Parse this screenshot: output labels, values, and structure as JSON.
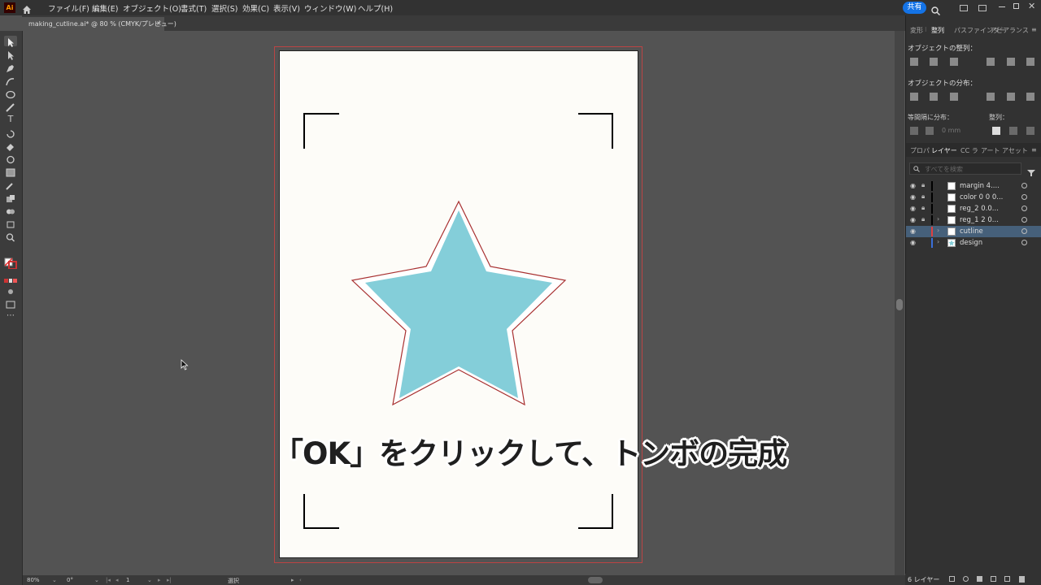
{
  "app": {
    "logo": "Ai",
    "menu": [
      "ファイル(F)",
      "編集(E)",
      "オブジェクト(O)",
      "書式(T)",
      "選択(S)",
      "効果(C)",
      "表示(V)",
      "ウィンドウ(W)",
      "ヘルプ(H)"
    ],
    "share_label": "共有"
  },
  "document_tab": {
    "title": "making_cutline.ai* @ 80 % (CMYK/プレビュー)",
    "close": "×"
  },
  "status_bar": {
    "zoom": "80%",
    "rotation": "0°",
    "artboard_number": "1",
    "tool_status": "選択"
  },
  "panel": {
    "top_tabs": [
      "変形",
      "整列",
      "パスファインダー",
      "アピアランス"
    ],
    "align_objects_label": "オブジェクトの整列：",
    "distribute_objects_label": "オブジェクトの分布：",
    "distribute_spacing_label": "等間隔に分布：",
    "spacing_value": "0 mm",
    "align_to_label": "整列：",
    "layer_tabs": [
      "プロパ",
      "レイヤー",
      "CC ラ",
      "アート",
      "アセット"
    ],
    "search_placeholder": "すべてを検索",
    "layers": [
      {
        "name": "margin 4....",
        "locked": true,
        "color": "#000000",
        "selected": false,
        "expandable": false
      },
      {
        "name": "color 0 0 0...",
        "locked": true,
        "color": "#000000",
        "selected": false,
        "expandable": false
      },
      {
        "name": "reg_2 0.0...",
        "locked": true,
        "color": "#000000",
        "selected": false,
        "expandable": false
      },
      {
        "name": "reg_1 2 0...",
        "locked": true,
        "color": "#000000",
        "selected": false,
        "expandable": true
      },
      {
        "name": "cutline",
        "locked": false,
        "color": "#e04040",
        "selected": true,
        "expandable": true
      },
      {
        "name": "design",
        "locked": false,
        "color": "#3a6fd8",
        "selected": false,
        "expandable": true
      }
    ],
    "layer_count": "6 レイヤー"
  },
  "caption": "「OK」をクリックして、トンボの完成",
  "colors": {
    "star_fill": "#84ced9",
    "cutline": "#a83030",
    "artboard": "#fdfcf8",
    "accent": "#1473e6"
  }
}
